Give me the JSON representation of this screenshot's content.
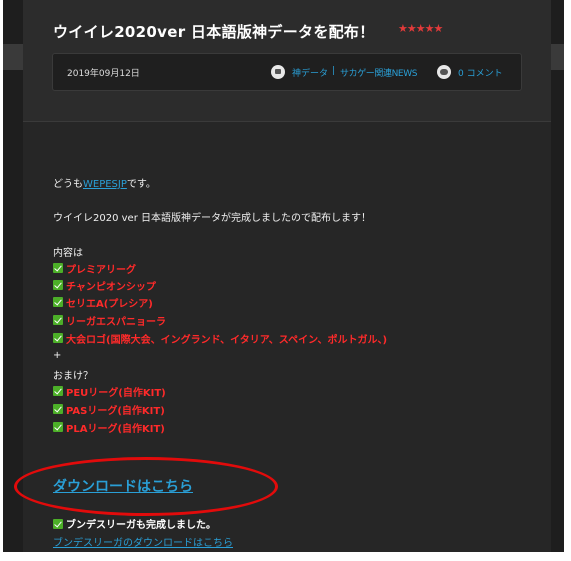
{
  "post": {
    "title": "ウイイレ2020ver 日本語版神データを配布！",
    "rating_stars": "★★★★★",
    "date": "2019年09月12日",
    "category_1": "神データ",
    "separator": "|",
    "category_2": "サカゲー関連NEWS",
    "comments": "0 コメント"
  },
  "body": {
    "greeting_prefix": "どうも",
    "greeting_link": "WEPESJP",
    "greeting_suffix": "です。",
    "intro": "ウイイレ2020 ver 日本語版神データが完成しましたので配布します！",
    "contents_label": "内容は",
    "items": [
      "プレミアリーグ",
      "チャンピオンシップ",
      "セリエA(プレシア)",
      "リーガエスパニョーラ",
      "大会ロゴ(国際大会、イングランド、イタリア、スペイン、ポルトガル、)"
    ],
    "plus": "+",
    "bonus_label": "おまけ？",
    "bonus_items": [
      "PEUリーグ(自作KIT)",
      "PASリーグ(自作KIT)",
      "PLAリーグ(自作KIT)"
    ],
    "download_link": "ダウンロードはこちら",
    "bundes_done": "ブンデスリーガも完成しました。",
    "bundes_link": "ブンデスリーガのダウンロードはこちら"
  },
  "colors": {
    "page_bg": "#262626",
    "link": "#2a9fd6",
    "highlight_red": "#ff2a2a",
    "check_green": "#4caf28",
    "annotation_oval": "#e20b0b"
  },
  "icons": {
    "category": "folder-icon",
    "comments": "speech-bubble-icon",
    "check": "green-check-icon"
  }
}
